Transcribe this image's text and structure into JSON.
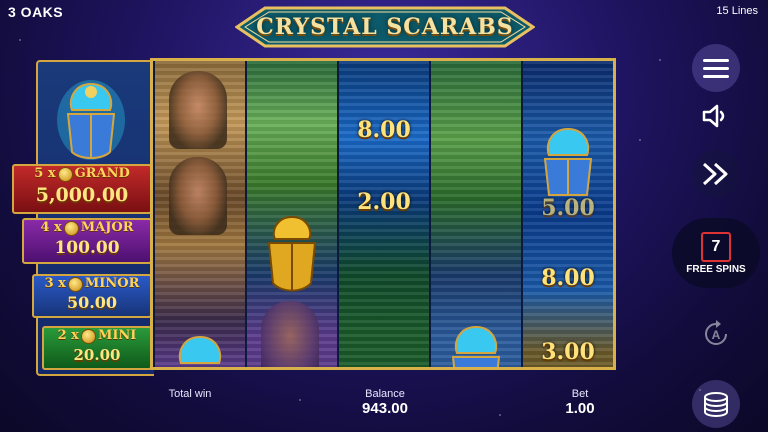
{
  "header": {
    "brand": "3 OAKS",
    "game_title": "CRYSTAL SCARABS",
    "lines": "15 Lines"
  },
  "jackpots": {
    "grand": {
      "multiplier": "5 x",
      "name": "GRAND",
      "value": "5,000.00"
    },
    "major": {
      "multiplier": "4 x",
      "name": "MAJOR",
      "value": "100.00"
    },
    "minor": {
      "multiplier": "3 x",
      "name": "MINOR",
      "value": "50.00"
    },
    "mini": {
      "multiplier": "2 x",
      "name": "MINI",
      "value": "20.00"
    }
  },
  "reels": {
    "reel3_values": [
      "8.00",
      "2.00"
    ],
    "reel5_values": [
      "5.00",
      "8.00",
      "3.00"
    ]
  },
  "controls": {
    "menu_icon": "hamburger-menu-icon",
    "sound_icon": "speaker-icon",
    "turbo_icon": "fast-forward-icon",
    "autoplay_icon": "autoplay-icon",
    "stake_icon": "coin-stack-icon"
  },
  "free_spins": {
    "count": "7",
    "label": "FREE SPINS"
  },
  "footer": {
    "total_win_label": "Total win",
    "balance_label": "Balance",
    "balance_value": "943.00",
    "bet_label": "Bet",
    "bet_value": "1.00"
  },
  "colors": {
    "frame_gold": "#d9b14a",
    "grand": "#c22a2a",
    "major": "#8a2aa8",
    "minor": "#2a5ac8",
    "mini": "#2a9a3a",
    "value_gold": "#ffe27a"
  }
}
